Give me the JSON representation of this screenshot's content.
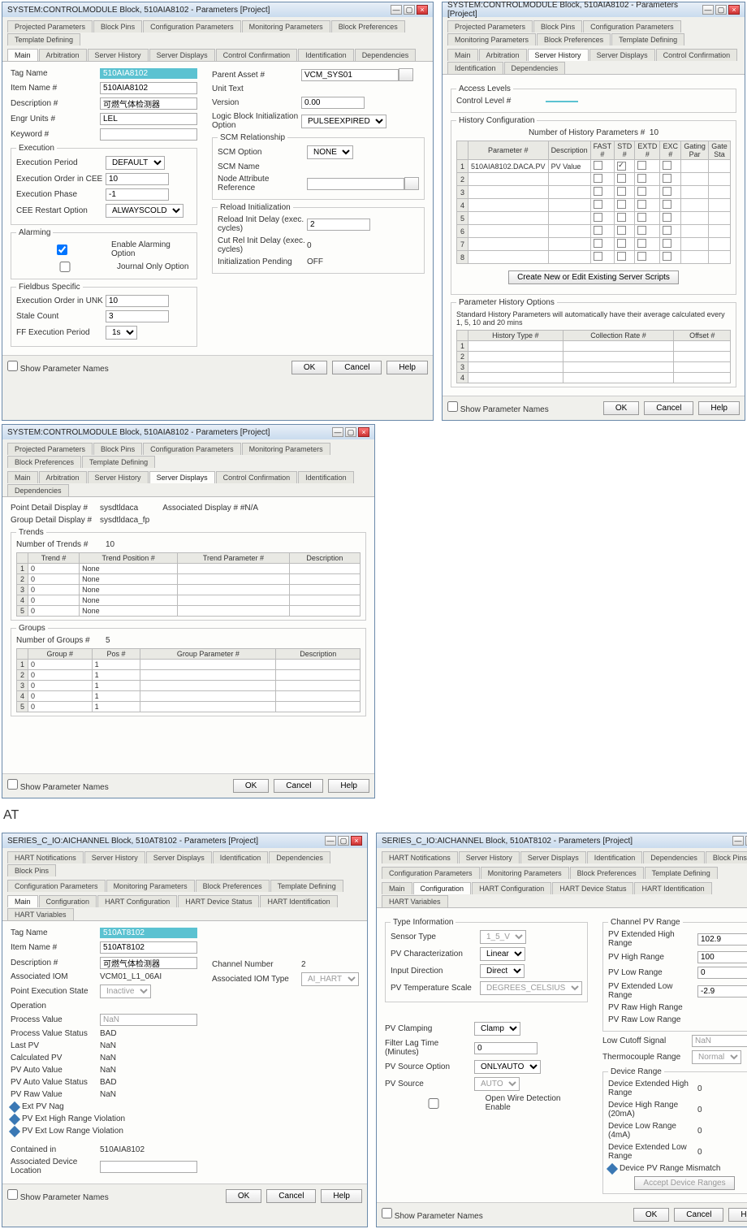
{
  "windows": {
    "w1": {
      "title": "SYSTEM:CONTROLMODULE Block, 510AIA8102 - Parameters [Project]",
      "tabs_row1": [
        "Projected Parameters",
        "Block Pins",
        "Configuration Parameters",
        "Monitoring Parameters",
        "Block Preferences",
        "Template Defining"
      ],
      "tabs_row2": [
        "Main",
        "Arbitration",
        "Server History",
        "Server Displays",
        "Control Confirmation",
        "Identification",
        "Dependencies"
      ],
      "active_tab": "Main",
      "fields": {
        "tag_name": "510AIA8102",
        "item_name": "510AIA8102",
        "description": "可燃气体检测器",
        "engr_units": "LEL",
        "keyword": "",
        "execution_period": "DEFAULT",
        "exec_order_cee": "10",
        "exec_phase": "-1",
        "cee_restart": "ALWAYSCOLD",
        "parent_asset": "VCM_SYS01",
        "unit_text": "",
        "version": "0.00",
        "logic_block_init": "PULSEEXPIRED",
        "scm_option": "NONE",
        "scm_name": "",
        "node_attr_ref": "",
        "reload_init_delay": "2",
        "cut_rel_init_delay": "0",
        "init_pending": "OFF",
        "exec_order_unk": "10",
        "stale_count": "3",
        "ff_exec_period": "1s"
      },
      "chk_enable_alarming": true,
      "chk_journal_only": false,
      "show_param_names": false
    },
    "w2": {
      "title": "SYSTEM:CONTROLMODULE Block, 510AIA8102 - Parameters [Project]",
      "tabs_row1": [
        "Projected Parameters",
        "Block Pins",
        "Configuration Parameters",
        "Monitoring Parameters",
        "Block Preferences",
        "Template Defining"
      ],
      "tabs_row2": [
        "Main",
        "Arbitration",
        "Server History",
        "Server Displays",
        "Control Confirmation",
        "Identification",
        "Dependencies"
      ],
      "active_tab": "Server History",
      "control_level": "",
      "num_hist_params": "10",
      "hist_columns": [
        "Parameter #",
        "Description",
        "FAST #",
        "STD #",
        "EXTD #",
        "EXC #",
        "Gating Par",
        "Gate Sta"
      ],
      "hist_row1": [
        "1",
        "510AIA8102.DACA.PV",
        "PV Value",
        "",
        "",
        "",
        "",
        ""
      ],
      "create_btn": "Create New or Edit Existing Server Scripts",
      "std_note": "Standard History Parameters will automatically have their average calculated every 1, 5, 10 and 20 mins",
      "hist_opt_cols": [
        "History Type #",
        "Collection Rate #",
        "Offset #"
      ],
      "show_param_names": false
    },
    "w3": {
      "title": "SYSTEM:CONTROLMODULE Block, 510AIA8102 - Parameters [Project]",
      "tabs_row1": [
        "Projected Parameters",
        "Block Pins",
        "Configuration Parameters",
        "Monitoring Parameters",
        "Block Preferences",
        "Template Defining"
      ],
      "tabs_row2": [
        "Main",
        "Arbitration",
        "Server History",
        "Server Displays",
        "Control Confirmation",
        "Identification",
        "Dependencies"
      ],
      "active_tab": "Server Displays",
      "point_detail_display": "sysdtldaca",
      "group_detail_display": "sysdtldaca_fp",
      "assoc_display": "#N/A",
      "num_trends": "10",
      "trend_cols": [
        "Trend #",
        "Trend Position #",
        "Trend Parameter #",
        "Description"
      ],
      "trend_rows": [
        [
          "1",
          "0",
          "None",
          ""
        ],
        [
          "2",
          "0",
          "None",
          ""
        ],
        [
          "3",
          "0",
          "None",
          ""
        ],
        [
          "4",
          "0",
          "None",
          ""
        ],
        [
          "5",
          "0",
          "None",
          ""
        ]
      ],
      "num_groups": "5",
      "group_cols": [
        "Group #",
        "Pos #",
        "Group Parameter #",
        "Description"
      ],
      "group_rows": [
        [
          "1",
          "0",
          "1",
          ""
        ],
        [
          "2",
          "0",
          "1",
          ""
        ],
        [
          "3",
          "0",
          "1",
          ""
        ],
        [
          "4",
          "0",
          "1",
          ""
        ],
        [
          "5",
          "0",
          "1",
          ""
        ]
      ],
      "show_param_names": false
    },
    "w4": {
      "title": "SERIES_C_IO:AICHANNEL Block, 510AT8102 - Parameters [Project]",
      "tabs_row1": [
        "HART Notifications",
        "Server History",
        "Server Displays",
        "Identification",
        "Dependencies",
        "Block Pins"
      ],
      "tabs_row2": [
        "Configuration Parameters",
        "Monitoring Parameters",
        "Block Preferences",
        "Template Defining"
      ],
      "tabs_row3": [
        "Main",
        "Configuration",
        "HART Configuration",
        "HART Device Status",
        "HART Identification",
        "HART Variables"
      ],
      "active_tab": "Main",
      "fields": {
        "tag_name": "510AT8102",
        "item_name": "510AT8102",
        "description": "可燃气体检测器",
        "channel_number": "2",
        "associated_iom": "VCM01_L1_06AI",
        "assoc_iom_type": "AI_HART",
        "point_exec_state": "Inactive",
        "operation": "",
        "process_value": "NaN",
        "process_value_status": "BAD",
        "last_pv": "NaN",
        "calculated_pv": "NaN",
        "pv_auto_value": "NaN",
        "pv_auto_value_status": "BAD",
        "pv_raw_value": "NaN",
        "contained_in": "510AIA8102",
        "assoc_device_loc": ""
      },
      "chk_ext_hi": true,
      "chk_ext_lo": true,
      "show_param_names": false
    },
    "w5": {
      "title": "SERIES_C_IO:AICHANNEL Block, 510AT8102 - Parameters [Project]",
      "tabs_row1": [
        "HART Notifications",
        "Server History",
        "Server Displays",
        "Identification",
        "Dependencies",
        "Block Pins"
      ],
      "tabs_row2": [
        "Configuration Parameters",
        "Monitoring Parameters",
        "Block Preferences",
        "Template Defining"
      ],
      "tabs_row3": [
        "Main",
        "Configuration",
        "HART Configuration",
        "HART Device Status",
        "HART Identification",
        "HART Variables"
      ],
      "active_tab": "Configuration",
      "fields": {
        "sensor_type": "1_5_V",
        "pv_char": "Linear",
        "input_direction": "Direct",
        "pv_temp_scale": "DEGREES_CELSIUS",
        "pv_ext_hi": "102.9",
        "pv_hi": "100",
        "pv_lo": "0",
        "pv_ext_lo": "-2.9",
        "pv_raw_hi": "",
        "pv_raw_lo": "",
        "pv_clamping": "Clamp",
        "low_cutoff": "NaN",
        "filter_lag": "0",
        "tc_range": "Normal",
        "pv_source_option": "ONLYAUTO",
        "pv_source": "AUTO",
        "dev_ext_hi": "0",
        "dev_hi_20ma": "0",
        "dev_lo_4ma": "0",
        "dev_ext_lo": "0"
      },
      "open_wire_detect": false,
      "device_range_mismatch": true,
      "accept_btn": "Accept Device Ranges",
      "show_param_names": false
    }
  },
  "buttons": {
    "ok": "OK",
    "cancel": "Cancel",
    "help": "Help"
  },
  "at_label": "AT"
}
